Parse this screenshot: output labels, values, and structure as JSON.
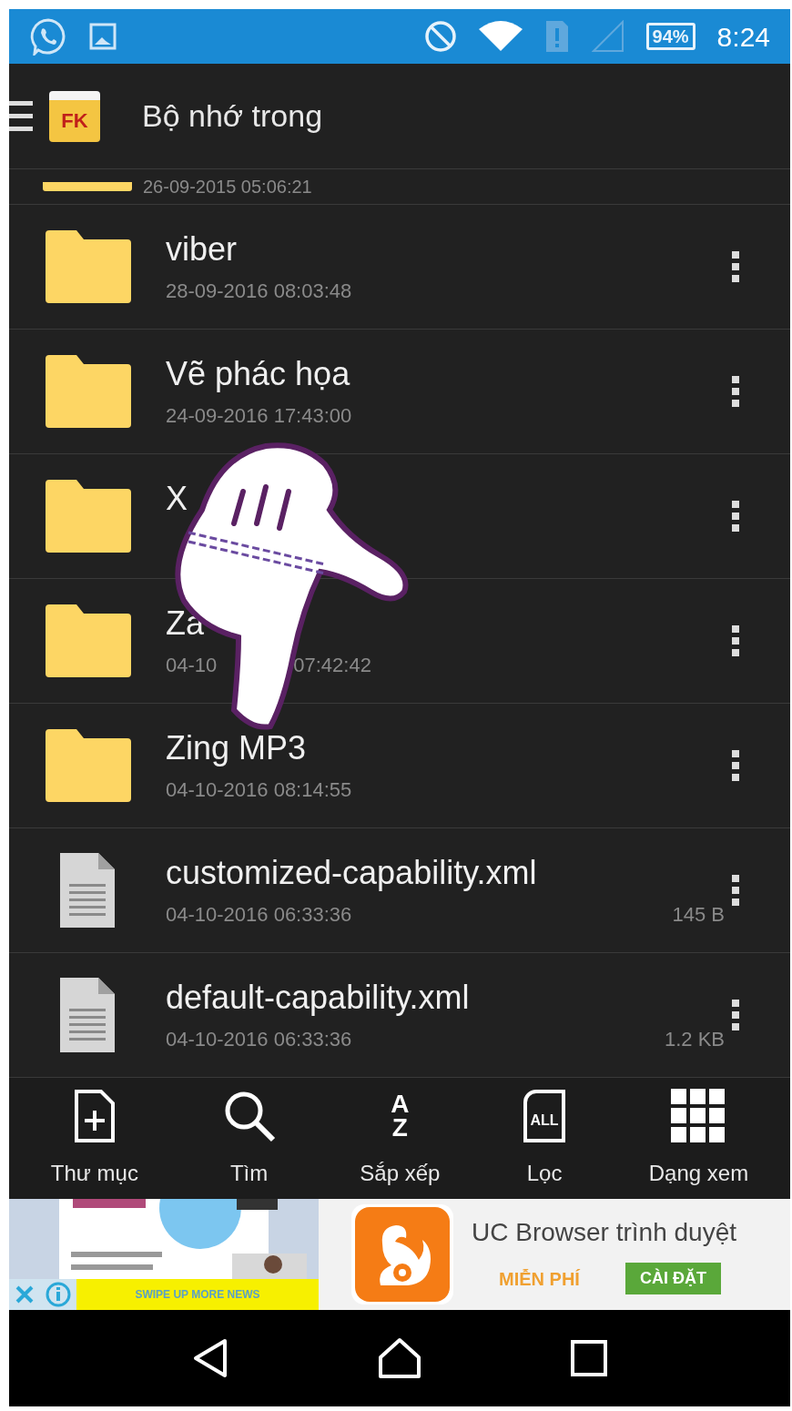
{
  "status_bar": {
    "battery": "94%",
    "time": "8:24"
  },
  "toolbar": {
    "title": "Bộ nhớ trong",
    "app_logo": "FK"
  },
  "partial_row": {
    "date": "26-09-2015 05:06:21"
  },
  "files": [
    {
      "kind": "folder",
      "name": "viber",
      "date_parts": [
        "28-09-2016 08:03:48"
      ]
    },
    {
      "kind": "folder",
      "name": "Vẽ phác họa",
      "date_parts": [
        "24-09-2016 17:43:00"
      ]
    },
    {
      "kind": "folder",
      "name": "X"
    },
    {
      "kind": "folder",
      "name": "Za",
      "date_parts": [
        "04-10",
        "07:42:42"
      ]
    },
    {
      "kind": "folder",
      "name": "Zing MP3",
      "date_parts": [
        "04-10-2016 08:14:55"
      ]
    },
    {
      "kind": "file",
      "name": "customized-capability.xml",
      "date_parts": [
        "04-10-2016 06:33:36"
      ],
      "size": "145 B"
    },
    {
      "kind": "file",
      "name": "default-capability.xml",
      "date_parts": [
        "04-10-2016 06:33:36"
      ],
      "size": "1.2 KB"
    }
  ],
  "bottom_actions": [
    {
      "kind": "new-folder",
      "label": "Thư mục"
    },
    {
      "kind": "search",
      "label": "Tìm"
    },
    {
      "kind": "sort",
      "label": "Sắp xếp",
      "glyph_top": "A",
      "glyph_bottom": "Z"
    },
    {
      "kind": "filter",
      "label": "Lọc",
      "glyph": "ALL"
    },
    {
      "kind": "view",
      "label": "Dạng xem"
    }
  ],
  "ad": {
    "swipe_text": "SWIPE UP MORE NEWS",
    "title": "UC Browser trình duyệt",
    "free_label": "MIỄN PHÍ",
    "install_button": "CÀI ĐẶT"
  }
}
